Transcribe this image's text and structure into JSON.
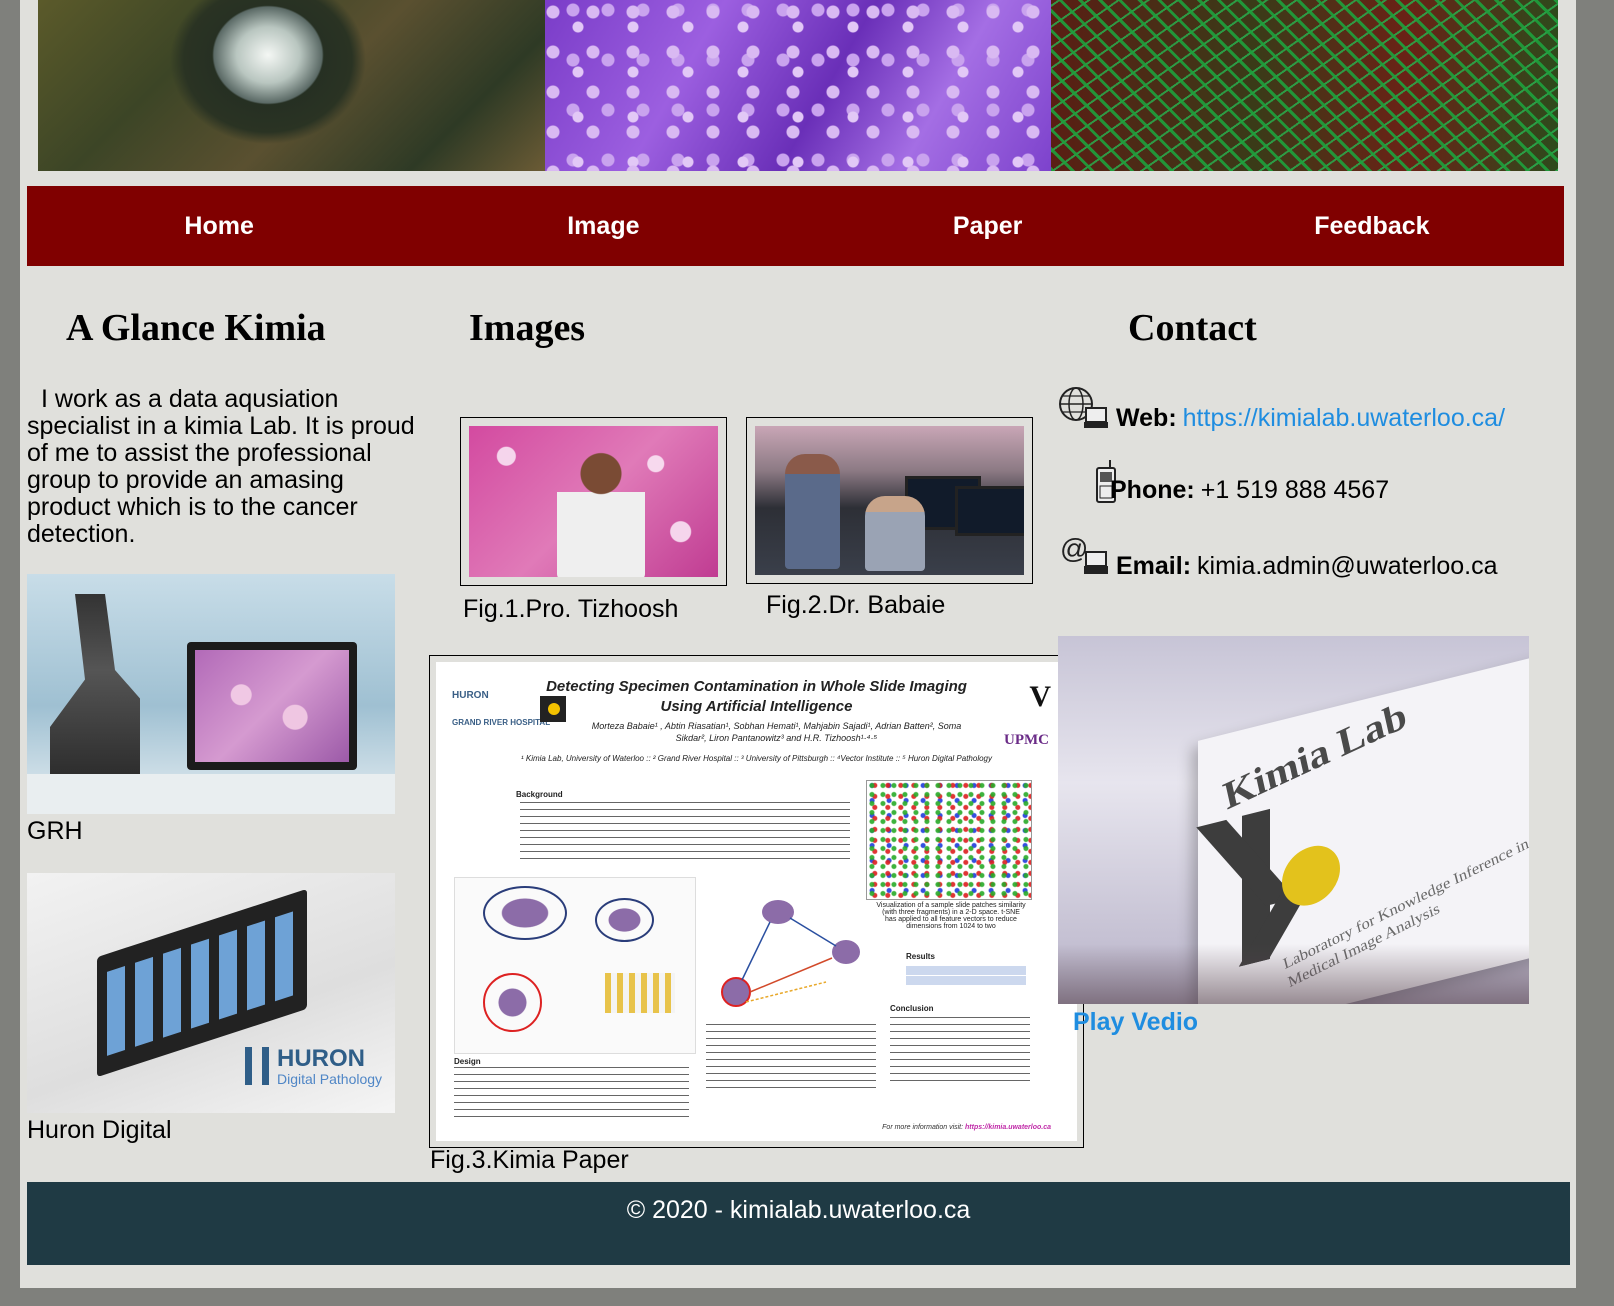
{
  "nav": {
    "items": [
      "Home",
      "Image",
      "Paper",
      "Feedback"
    ]
  },
  "glance": {
    "title": "A Glance Kimia",
    "intro": "I work as a data aqusiation specialist in a kimia Lab. It is proud of me to assist the professional group to provide an amasing product which is to the cancer detection.",
    "photos": [
      {
        "caption": "GRH"
      },
      {
        "caption": "Huron Digital",
        "logo_name": "HURON",
        "logo_sub": "Digital Pathology"
      }
    ]
  },
  "images": {
    "title": "Images",
    "figures": [
      {
        "caption": "Fig.1.Pro. Tizhoosh"
      },
      {
        "caption": "Fig.2.Dr. Babaie"
      }
    ],
    "paper": {
      "caption": "Fig.3.Kimia Paper",
      "title_line1": "Detecting Specimen Contamination in Whole Slide Imaging",
      "title_line2": "Using Artificial Intelligence",
      "authors": "Morteza Babaie¹ , Abtin Riasatian¹, Sobhan Hemati¹, Mahjabin Sajadi¹, Adrian Batten², Soma Sikdar², Liron Pantanowitz³ and H.R. Tizhoosh¹·⁴·⁵",
      "affiliations": "¹ Kimia Lab, University of Waterloo :: ² Grand River Hospital :: ³ University of Pittsburgh :: ⁴Vector Institute :: ⁵ Huron Digital Pathology",
      "logo_huron": "HURON",
      "logo_grh": "GRAND RIVER HOSPITAL",
      "logo_upmc": "UPMC",
      "section_background": "Background",
      "section_design": "Design",
      "section_results": "Results",
      "section_conclusion": "Conclusion",
      "tsne_caption": "Visualization of a sample slide patches similarity (with three fragments) in a 2-D space. t-SNE has applied to all feature vectors to reduce dimensions from 1024 to two",
      "footer_text": "For more information visit:",
      "footer_link": "https://kimia.uwaterloo.ca"
    }
  },
  "contact": {
    "title": "Contact",
    "web_label": "Web:",
    "web_value": "https://kimialab.uwaterloo.ca/",
    "phone_label": "Phone:",
    "phone_value": "+1 519 888 4567",
    "email_label": "Email:",
    "email_value": "kimia.admin@uwaterloo.ca",
    "video": {
      "sign_title": "Kimia Lab",
      "sign_subtitle": "Laboratory for Knowledge Inference in Medical Image Analysis",
      "play_label": "Play Vedio"
    }
  },
  "footer": {
    "text": "© 2020 - kimialab.uwaterloo.ca"
  },
  "colors": {
    "nav_bg": "#800000",
    "footer_bg": "#1f3a44",
    "link": "#1f8de0",
    "page_bg": "#e0e0dc"
  }
}
